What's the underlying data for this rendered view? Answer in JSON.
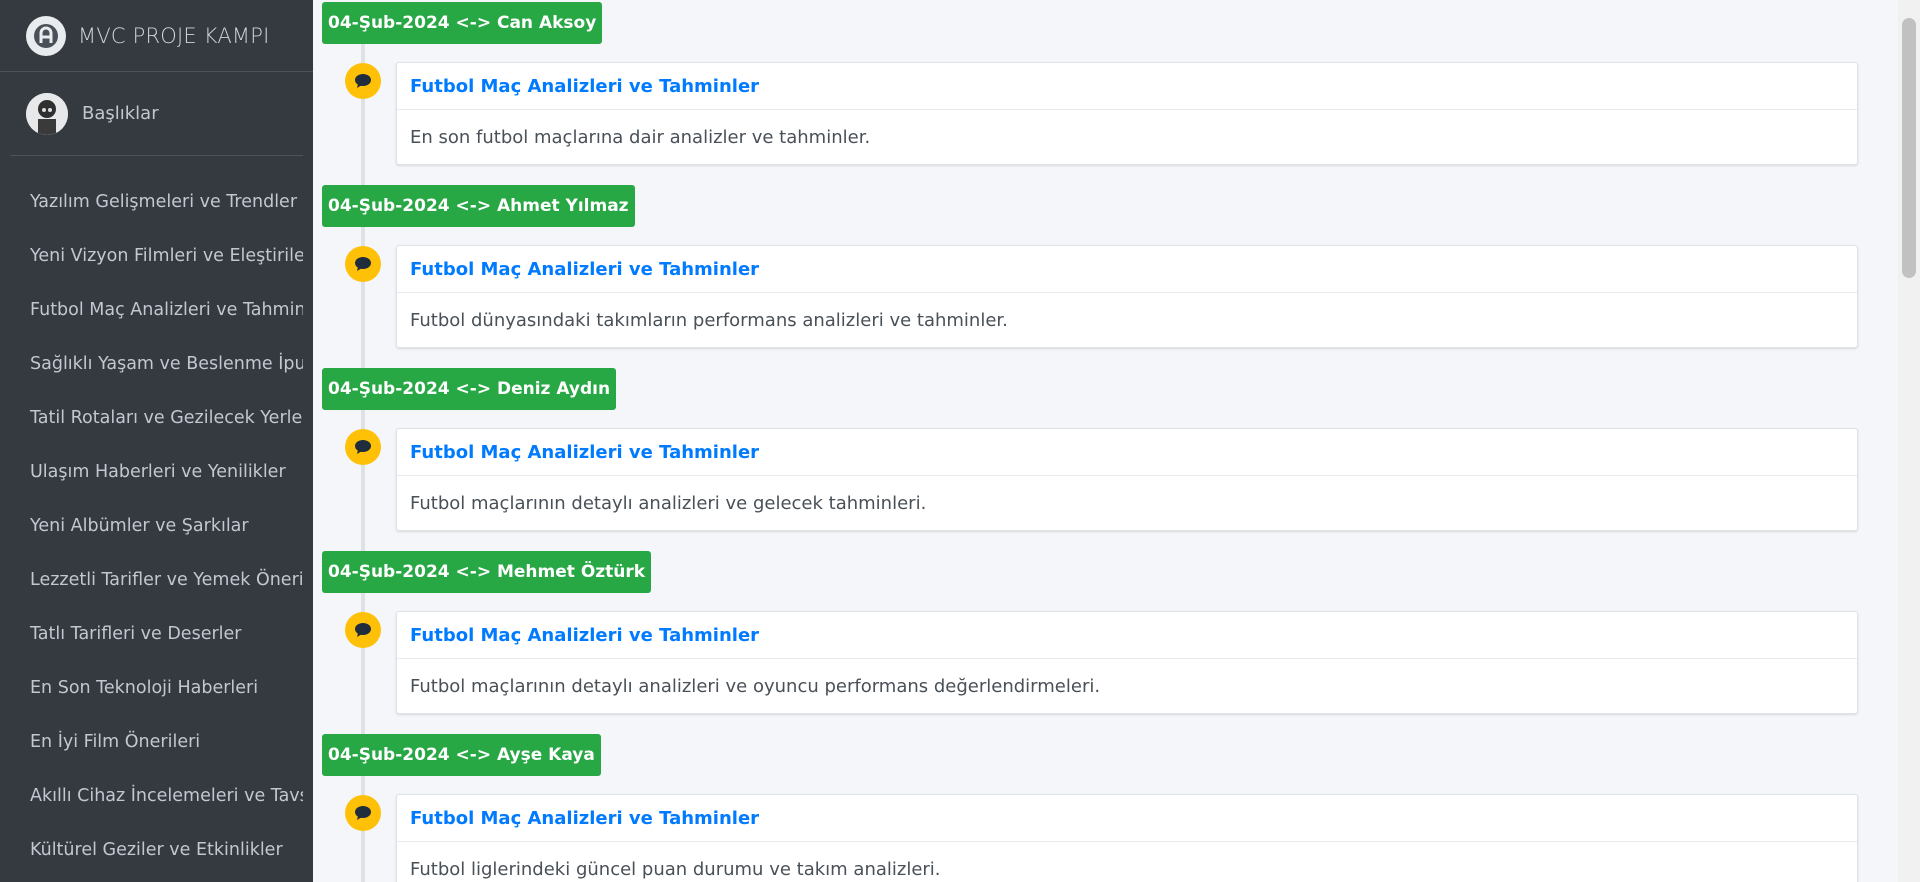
{
  "brand": {
    "title": "MVC PROJE KAMPI"
  },
  "user": {
    "name": "Başlıklar"
  },
  "sidebar": {
    "items": [
      {
        "label": "Yazılım Gelişmeleri ve Trendler"
      },
      {
        "label": "Yeni Vizyon Filmleri ve Eleştiriler"
      },
      {
        "label": "Futbol Maç Analizleri ve Tahminler"
      },
      {
        "label": "Sağlıklı Yaşam ve Beslenme İpuçları"
      },
      {
        "label": "Tatil Rotaları ve Gezilecek Yerler"
      },
      {
        "label": "Ulaşım Haberleri ve Yenilikler"
      },
      {
        "label": "Yeni Albümler ve Şarkılar"
      },
      {
        "label": "Lezzetli Tarifler ve Yemek Önerileri"
      },
      {
        "label": "Tatlı Tarifleri ve Deserler"
      },
      {
        "label": "En Son Teknoloji Haberleri"
      },
      {
        "label": "En İyi Film Önerileri"
      },
      {
        "label": "Akıllı Cihaz İncelemeleri ve Tavsiyeler"
      },
      {
        "label": "Kültürel Geziler ve Etkinlikler"
      }
    ]
  },
  "timeline": {
    "entries": [
      {
        "label": "04-Şub-2024 <-> Can Aksoy",
        "title": "Futbol Maç Analizleri ve Tahminler",
        "body": "En son futbol maçlarına dair analizler ve tahminler."
      },
      {
        "label": "04-Şub-2024 <-> Ahmet Yılmaz",
        "title": "Futbol Maç Analizleri ve Tahminler",
        "body": "Futbol dünyasındaki takımların performans analizleri ve tahminler."
      },
      {
        "label": "04-Şub-2024 <-> Deniz Aydın",
        "title": "Futbol Maç Analizleri ve Tahminler",
        "body": "Futbol maçlarının detaylı analizleri ve gelecek tahminleri."
      },
      {
        "label": "04-Şub-2024 <-> Mehmet Öztürk",
        "title": "Futbol Maç Analizleri ve Tahminler",
        "body": "Futbol maçlarının detaylı analizleri ve oyuncu performans değerlendirmeleri."
      },
      {
        "label": "04-Şub-2024 <-> Ayşe Kaya",
        "title": "Futbol Maç Analizleri ve Tahminler",
        "body": "Futbol liglerindeki güncel puan durumu ve takım analizleri."
      }
    ]
  },
  "colors": {
    "sidebar": "#343a40",
    "label": "#28a745",
    "bubble": "#ffc107",
    "link": "#007bff"
  },
  "icons": {
    "brand": "logo-icon",
    "entry": "comment-icon"
  }
}
